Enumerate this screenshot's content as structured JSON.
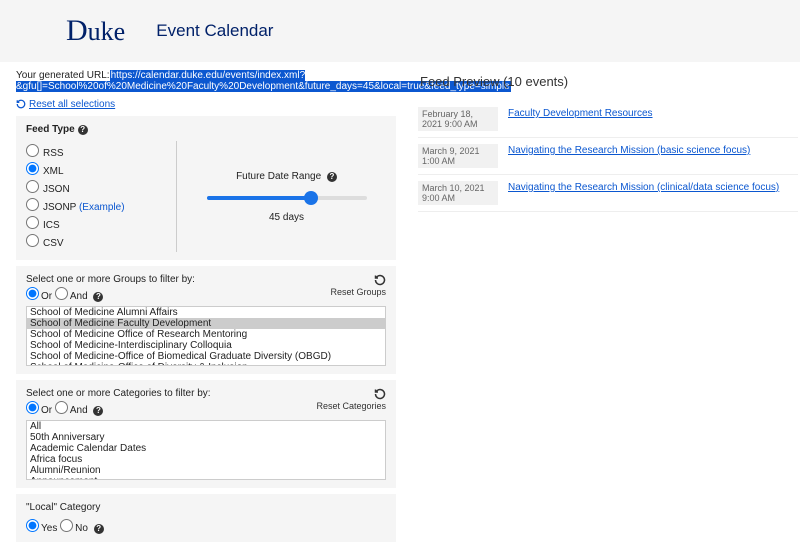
{
  "header": {
    "logo": "Duke",
    "title": "Event Calendar"
  },
  "url": {
    "label": "Your generated URL:",
    "value": "https://calendar.duke.edu/events/index.xml?&gfu[]=School%20of%20Medicine%20Faculty%20Development&future_days=45&local=true&feed_type=simple"
  },
  "reset_all": "Reset all selections",
  "feed_type": {
    "header": "Feed Type",
    "options": [
      "RSS",
      "XML",
      "JSON",
      "JSONP",
      "ICS",
      "CSV"
    ],
    "selected": "XML",
    "example": "(Example)",
    "range_label": "Future Date Range",
    "range_value": "45 days",
    "range_pct": 65
  },
  "groups": {
    "header": "Select one or more Groups to filter by:",
    "reset": "Reset Groups",
    "or": "Or",
    "and": "And",
    "items": [
      "School of Medicine Alumni Affairs",
      "School of Medicine Faculty Development",
      "School of Medicine Office of Research Mentoring",
      "School of Medicine-Interdisciplinary Colloquia",
      "School of Medicine-Office of Biomedical Graduate Diversity (OBGD)",
      "School of Medicine-Office of Diversity & Inclusion"
    ],
    "selected_index": 1
  },
  "categories": {
    "header": "Select one or more Categories to filter by:",
    "reset": "Reset Categories",
    "or": "Or",
    "and": "And",
    "items": [
      "All",
      "50th Anniversary",
      "Academic Calendar Dates",
      "Africa focus",
      "Alumni/Reunion",
      "Announcement"
    ]
  },
  "local": {
    "header": "\"Local\" Category",
    "yes": "Yes",
    "no": "No"
  },
  "preview": {
    "title": "Feed Preview (10 events)",
    "events": [
      {
        "date": "February 18, 2021 9:00 AM",
        "title": "Faculty Development Resources"
      },
      {
        "date": "March 9, 2021 1:00 AM",
        "title": "Navigating the Research Mission (basic science focus)"
      },
      {
        "date": "March 10, 2021 9:00 AM",
        "title": "Navigating the Research Mission (clinical/data science focus)"
      }
    ]
  }
}
